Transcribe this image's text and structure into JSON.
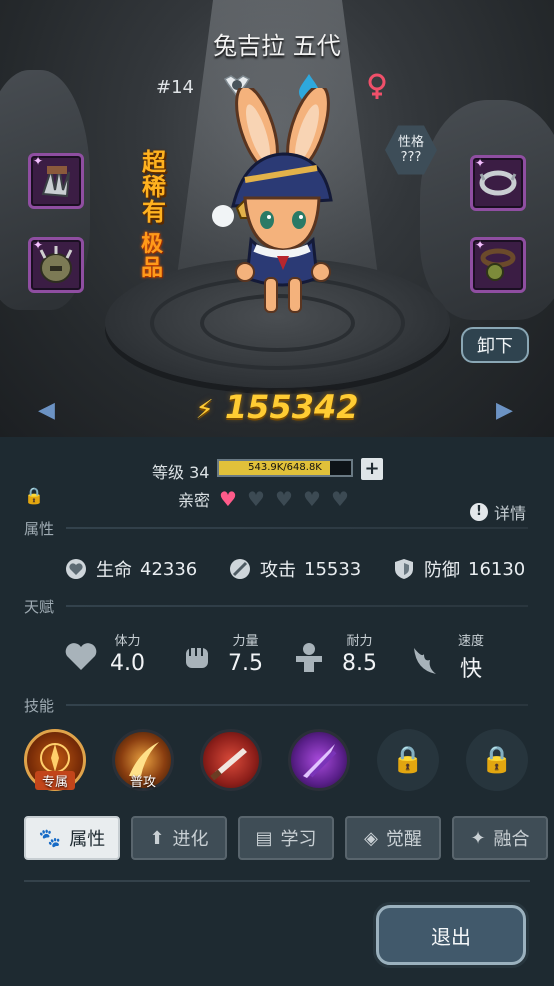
{
  "character": {
    "name": "兔吉拉 五代",
    "rank": "#14",
    "rarity": "超稀有",
    "grade": "极品",
    "personality_label": "性格",
    "personality_value": "???",
    "unequip_label": "卸下",
    "power": "155342"
  },
  "top_icons": [
    "shield-emblem-icon",
    "water-drop-icon",
    "female-icon"
  ],
  "equipment": {
    "left": [
      "claw-gauntlet-icon",
      "spiked-helmet-icon"
    ],
    "right": [
      "collar-ring-icon",
      "bell-collar-icon"
    ]
  },
  "progress": {
    "level_label": "等级 34",
    "xp_text": "543.9K/648.8K",
    "xp_fraction": 0.838,
    "affinity_label": "亲密",
    "affinity_total": 5,
    "affinity_filled": 1,
    "detail_label": "详情"
  },
  "sections": {
    "attributes": "属性",
    "talents": "天赋",
    "skills": "技能"
  },
  "stats": [
    {
      "label": "生命",
      "value": "42336",
      "icon": "heart-orb-icon"
    },
    {
      "label": "攻击",
      "value": "15533",
      "icon": "sword-orb-icon"
    },
    {
      "label": "防御",
      "value": "16130",
      "icon": "shield-icon"
    }
  ],
  "talents": [
    {
      "label": "体力",
      "value": "4.0",
      "icon": "heart-icon"
    },
    {
      "label": "力量",
      "value": "7.5",
      "icon": "fist-icon"
    },
    {
      "label": "耐力",
      "value": "8.5",
      "icon": "armor-icon"
    },
    {
      "label": "速度",
      "value": "快",
      "icon": "wing-icon"
    }
  ],
  "skills": [
    {
      "tag": "专属",
      "icon": "exclusive-skill-icon"
    },
    {
      "tag": "普攻",
      "icon": "basic-attack-icon"
    },
    {
      "tag": "",
      "icon": "blade-skill-icon"
    },
    {
      "tag": "",
      "icon": "shadow-strike-icon"
    },
    {
      "tag": "",
      "icon": "lock-icon"
    },
    {
      "tag": "",
      "icon": "lock-icon"
    }
  ],
  "tabs": [
    {
      "label": "属性",
      "icon": "paw-icon",
      "active": true
    },
    {
      "label": "进化",
      "icon": "evolve-arrow-icon",
      "active": false
    },
    {
      "label": "学习",
      "icon": "book-icon",
      "active": false
    },
    {
      "label": "觉醒",
      "icon": "awaken-icon",
      "active": false
    },
    {
      "label": "融合",
      "icon": "fusion-icon",
      "active": false
    }
  ],
  "exit_label": "退出",
  "colors": {
    "panel": "#1e2a31",
    "power": "#ffcc33",
    "rarity": "#ffb21f",
    "affinity_heart": "#ff5b8a",
    "epic_slot": "#8f4ea1"
  }
}
